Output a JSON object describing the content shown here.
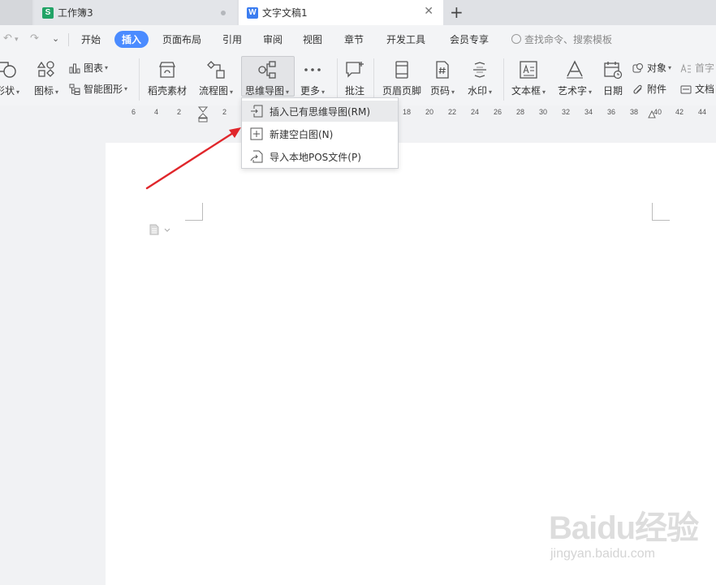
{
  "tabs": [
    {
      "label": "工作簿3",
      "badge": "S",
      "badge_color": "#21a366"
    },
    {
      "label": "文字文稿1",
      "badge": "W",
      "badge_color": "#3b7df0"
    }
  ],
  "new_tab": "+",
  "menu": {
    "items": [
      "开始",
      "插入",
      "页面布局",
      "引用",
      "审阅",
      "视图",
      "章节",
      "开发工具",
      "会员专享"
    ],
    "active": "插入",
    "search_placeholder": "查找命令、搜索模板"
  },
  "ribbon": {
    "shapes": "形状",
    "icons": "图标",
    "chart": "图表",
    "smart_graphic": "智能图形",
    "material": "稻壳素材",
    "flowchart": "流程图",
    "mindmap": "思维导图",
    "more": "更多",
    "comment": "批注",
    "header_footer": "页眉页脚",
    "page_number": "页码",
    "watermark": "水印",
    "textbox": "文本框",
    "wordart": "艺术字",
    "date": "日期",
    "object": "对象",
    "attachment": "附件",
    "dropcap": "首字",
    "document": "文档"
  },
  "ruler_ticks": [
    "6",
    "4",
    "2",
    "2",
    "18",
    "20",
    "22",
    "24",
    "26",
    "28",
    "30",
    "32",
    "34",
    "36",
    "38",
    "40",
    "42",
    "44"
  ],
  "dropdown": [
    {
      "label": "插入已有思维导图(RM)"
    },
    {
      "label": "新建空白图(N)"
    },
    {
      "label": "导入本地POS文件(P)"
    }
  ],
  "watermark_text": {
    "logo": "Baidu经验",
    "url": "jingyan.baidu.com"
  },
  "colors": {
    "accent": "#4a8bff",
    "arrow": "#e0262b"
  }
}
